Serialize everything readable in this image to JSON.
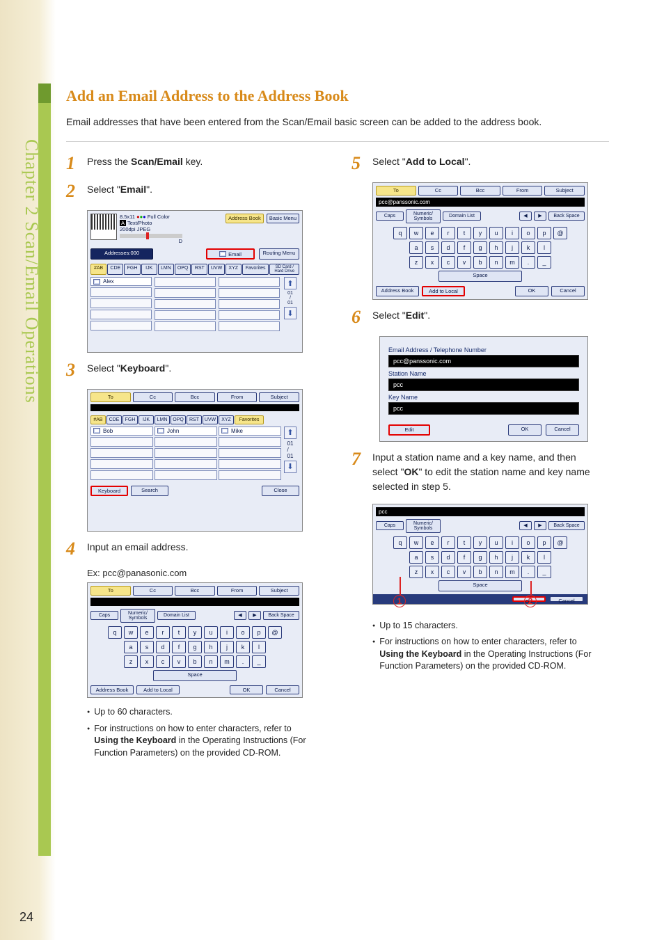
{
  "side_tab": "Chapter 2    Scan/Email Operations",
  "page_number": "24",
  "title": "Add an Email Address to the Address Book",
  "intro": "Email addresses that have been entered from the Scan/Email basic screen can be added to the address book.",
  "steps": {
    "s1": {
      "num": "1",
      "text_a": "Press the ",
      "b": "Scan/Email",
      "text_b": " key."
    },
    "s2": {
      "num": "2",
      "text_a": "Select \"",
      "b": "Email",
      "text_b": "\"."
    },
    "s3": {
      "num": "3",
      "text_a": "Select \"",
      "b": "Keyboard",
      "text_b": "\"."
    },
    "s4": {
      "num": "4",
      "text": "Input an email address."
    },
    "s4_caption": "Ex: pcc@panasonic.com",
    "s4_bullets": [
      "Up to 60 characters.",
      "For instructions on how to enter characters, refer to Using the Keyboard in the Operating Instructions (For Function Parameters) on the provided CD-ROM."
    ],
    "s5": {
      "num": "5",
      "text_a": "Select \"",
      "b": "Add to Local",
      "text_b": "\"."
    },
    "s6": {
      "num": "6",
      "text_a": "Select \"",
      "b": "Edit",
      "text_b": "\"."
    },
    "s7": {
      "num": "7",
      "text": "Input a station name and a key name, and then select \"OK\" to edit the station name and key name selected in step 5."
    },
    "s7_bullets": [
      "Up to 15 characters.",
      "For instructions on how to enter characters, refer to Using the Keyboard in the Operating Instructions (For Function Parameters) on the provided CD-ROM."
    ]
  },
  "shotA": {
    "size": "8.5x11",
    "color": "Full Color",
    "mode": "Text/Photo",
    "res": "200dpi JPEG",
    "range_label": "D",
    "address_book": "Address Book",
    "basic_menu": "Basic Menu",
    "addresses": "Addresses:000",
    "email": "Email",
    "routing": "Routing Menu",
    "tabs": [
      "#AB",
      "CDE",
      "FGH",
      "IJK",
      "LMN",
      "OPQ",
      "RST",
      "UVW",
      "XYZ"
    ],
    "fav": "Favorites",
    "sd": "SD Card / Hard Drive",
    "alex": "Alex",
    "frac": "01\n/\n01"
  },
  "shotB": {
    "top": [
      "To",
      "Cc",
      "Bcc",
      "From",
      "Subject"
    ],
    "tabs": [
      "#AB",
      "CDE",
      "FGH",
      "IJK",
      "LMN",
      "OPQ",
      "RST",
      "UVW",
      "XYZ"
    ],
    "fav": "Favorites",
    "names": [
      "Bob",
      "John",
      "Mike"
    ],
    "frac": "01\n/\n01",
    "keyboard": "Keyboard",
    "search": "Search",
    "close": "Close"
  },
  "shotC": {
    "top": [
      "To",
      "Cc",
      "Bcc",
      "From",
      "Subject"
    ],
    "caps": "Caps",
    "numsym": "Numeric/\nSymbols",
    "domain": "Domain List",
    "back": "Back Space",
    "rows": [
      [
        "q",
        "w",
        "e",
        "r",
        "t",
        "y",
        "u",
        "i",
        "o",
        "p",
        "@"
      ],
      [
        "a",
        "s",
        "d",
        "f",
        "g",
        "h",
        "j",
        "k",
        "l"
      ],
      [
        "z",
        "x",
        "c",
        "v",
        "b",
        "n",
        "m",
        ".",
        "_"
      ]
    ],
    "space": "Space",
    "address_book": "Address Book",
    "add_local": "Add to Local",
    "ok": "OK",
    "cancel": "Cancel"
  },
  "shotD": {
    "email_display": "pcc@panssonic.com",
    "top": [
      "To",
      "Cc",
      "Bcc",
      "From",
      "Subject"
    ]
  },
  "shotE": {
    "heading": "Email Address / Telephone Number",
    "email": "pcc@panssonic.com",
    "station_lbl": "Station Name",
    "station": "pcc",
    "key_lbl": "Key Name",
    "key": "pcc",
    "edit": "Edit",
    "ok": "OK",
    "cancel": "Cancel"
  },
  "shotF": {
    "input": "pcc",
    "ok": "OK",
    "cancel": "Cancel",
    "marker1": "1",
    "marker2": "2"
  }
}
